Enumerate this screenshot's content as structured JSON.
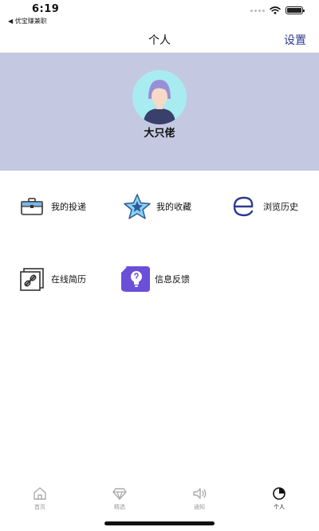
{
  "status_bar": {
    "time": "6:19",
    "back_app": "◀ 优宝赚兼职"
  },
  "nav": {
    "title": "个人",
    "settings_label": "设置"
  },
  "profile": {
    "name": "大只佬"
  },
  "menu": [
    {
      "label": "我的投递",
      "icon": "briefcase-icon"
    },
    {
      "label": "我的收藏",
      "icon": "star-icon"
    },
    {
      "label": "浏览历史",
      "icon": "history-e-icon"
    },
    {
      "label": "在线简历",
      "icon": "resume-link-icon"
    },
    {
      "label": "信息反馈",
      "icon": "feedback-lightbulb-icon"
    }
  ],
  "tabs": [
    {
      "label": "首页",
      "icon": "home-icon",
      "active": false
    },
    {
      "label": "精选",
      "icon": "diamond-icon",
      "active": false
    },
    {
      "label": "通知",
      "icon": "speaker-icon",
      "active": false
    },
    {
      "label": "个人",
      "icon": "profile-pie-icon",
      "active": true
    }
  ],
  "colors": {
    "header_bg": "#c4c9e1",
    "settings_text": "#2d3a8c",
    "avatar_bg": "#a8ecf2",
    "icon_accent": "#6b4fd8"
  }
}
